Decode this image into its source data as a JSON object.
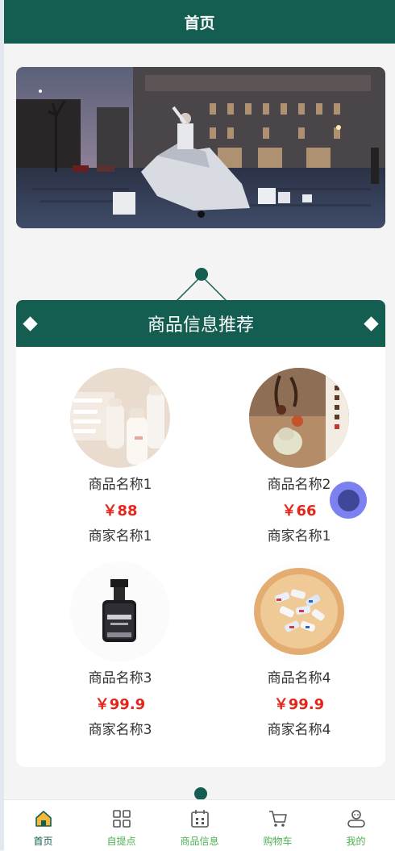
{
  "header": {
    "title": "首页"
  },
  "banner": {
    "image": "street-fashion-photo"
  },
  "section": {
    "title": "商品信息推荐"
  },
  "products": [
    {
      "name": "商品名称1",
      "price": "￥88",
      "merchant": "商家名称1",
      "image": "baby-bottles"
    },
    {
      "name": "商品名称2",
      "price": "￥66",
      "merchant": "商家名称1",
      "image": "jade-pendants"
    },
    {
      "name": "商品名称3",
      "price": "￥99.9",
      "merchant": "商家名称3",
      "image": "serum-bottle"
    },
    {
      "name": "商品名称4",
      "price": "￥99.9",
      "merchant": "商家名称4",
      "image": "candy-plate"
    }
  ],
  "tabbar": {
    "items": [
      {
        "label": "首页",
        "icon": "home-icon",
        "active": true
      },
      {
        "label": "自提点",
        "icon": "grid-icon",
        "active": false
      },
      {
        "label": "商品信息",
        "icon": "calendar-icon",
        "active": false
      },
      {
        "label": "购物车",
        "icon": "cart-icon",
        "active": false
      },
      {
        "label": "我的",
        "icon": "user-icon",
        "active": false
      }
    ]
  },
  "colors": {
    "primary": "#135e50",
    "price": "#e4261b",
    "tab_label": "#4caf50",
    "float_button": "#7b82f0"
  }
}
